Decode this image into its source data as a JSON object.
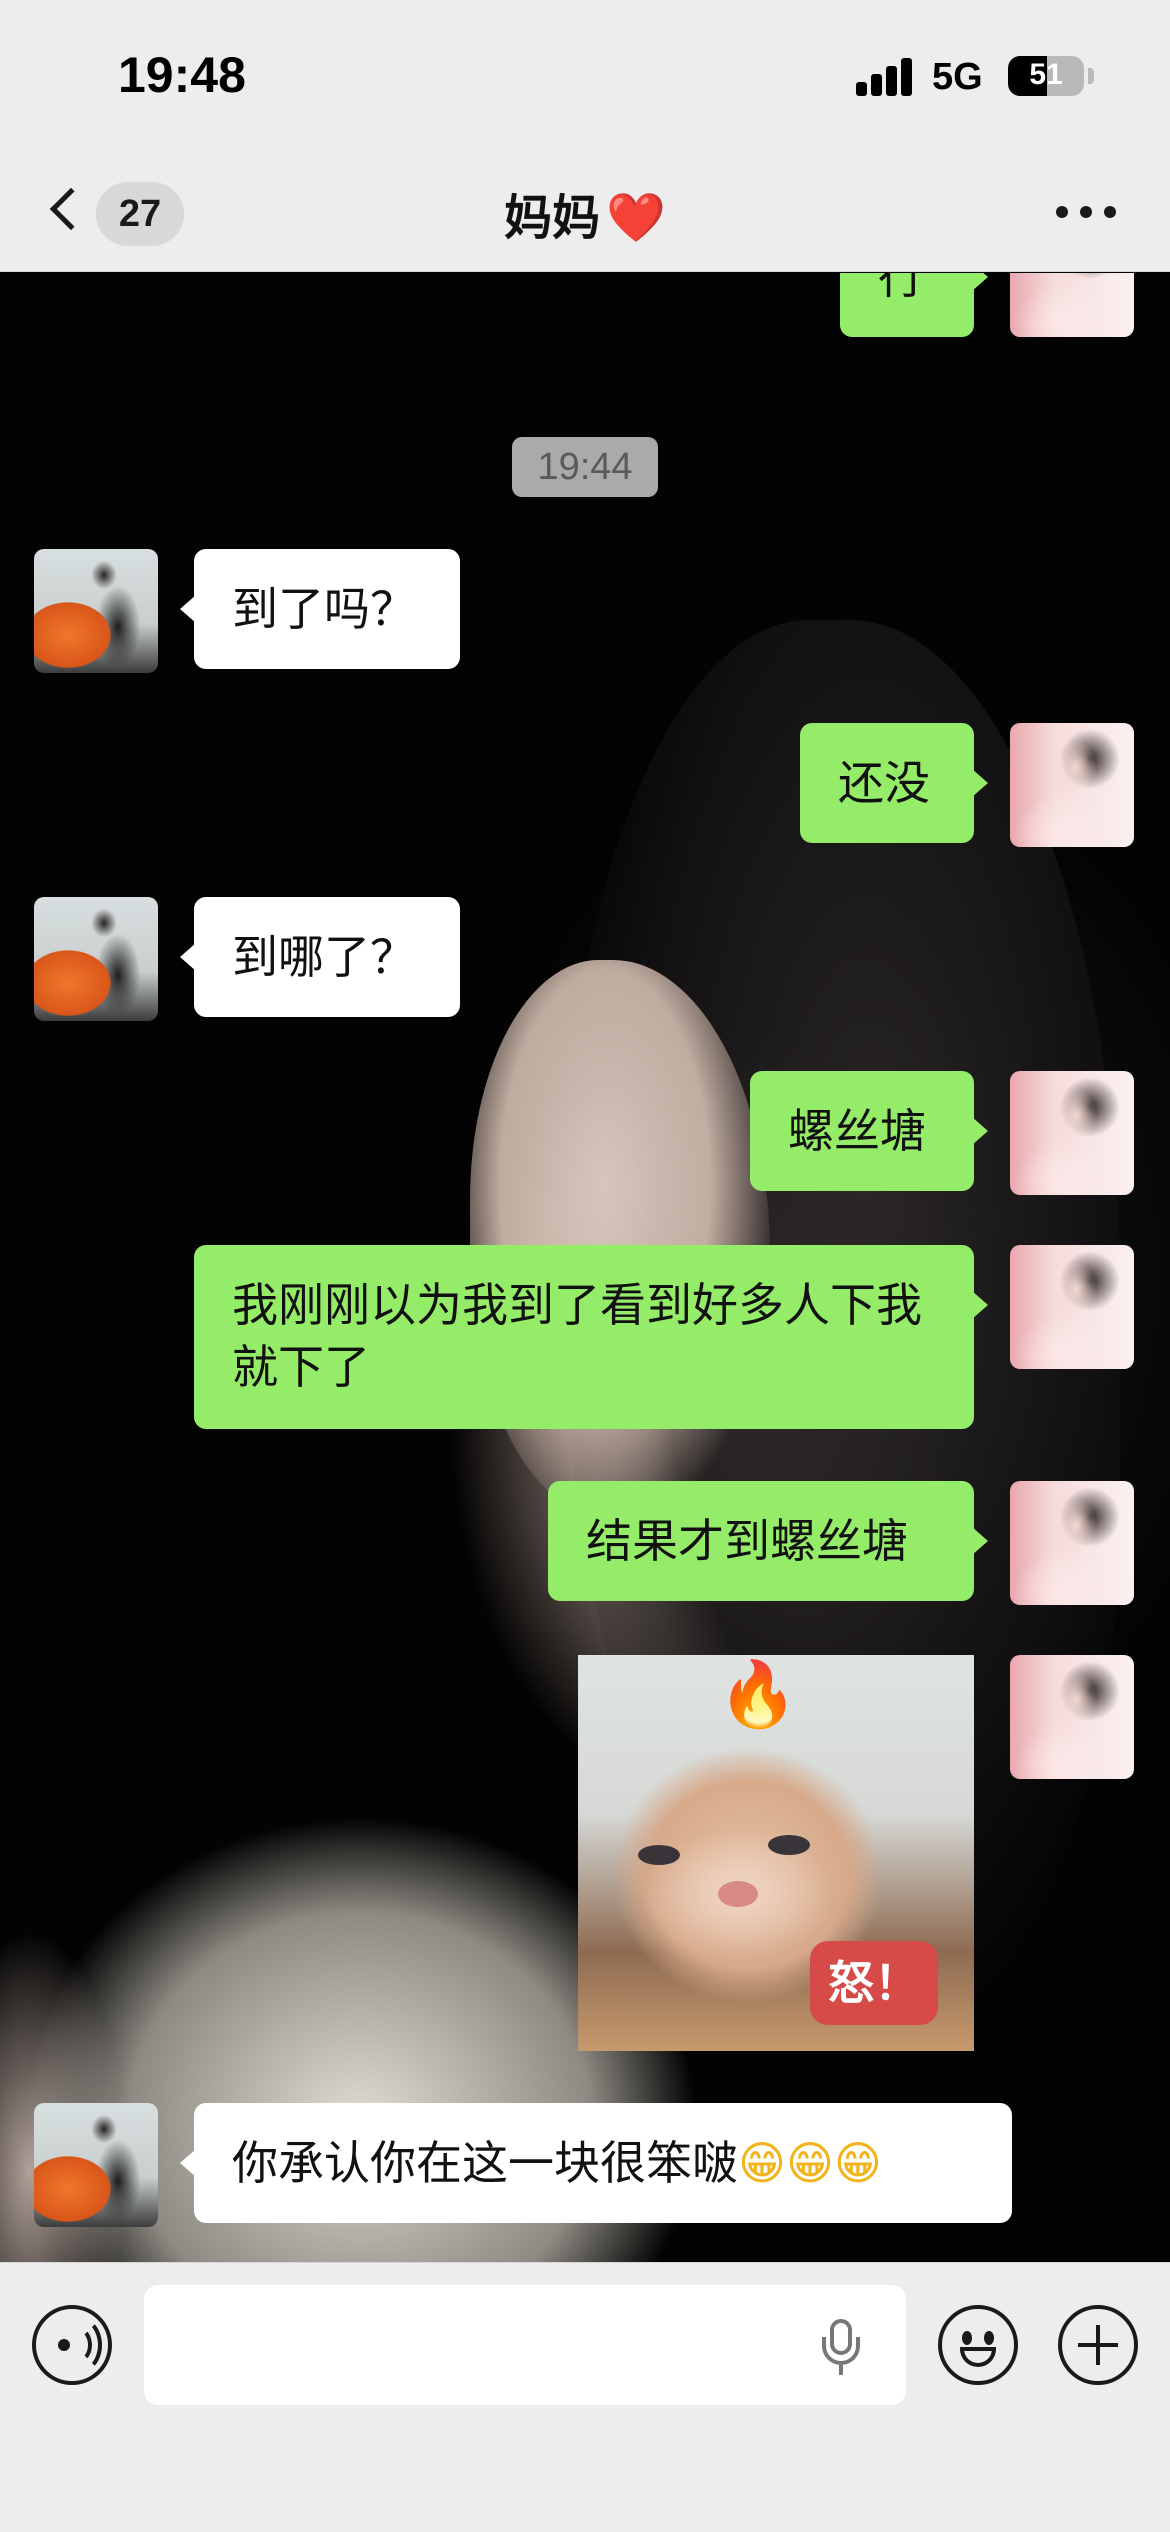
{
  "status_bar": {
    "time": "19:48",
    "network": "5G",
    "battery_level": "51",
    "battery_fraction": 0.51
  },
  "nav": {
    "unread_count": "27",
    "title": "妈妈",
    "title_emoji": "❤️"
  },
  "messages": [
    {
      "side": "sent",
      "text": "行"
    },
    {
      "type": "timestamp",
      "text": "19:44"
    },
    {
      "side": "received",
      "text": "到了吗？"
    },
    {
      "side": "sent",
      "text": "还没"
    },
    {
      "side": "received",
      "text": "到哪了？"
    },
    {
      "side": "sent",
      "text": "螺丝塘"
    },
    {
      "side": "sent",
      "text": "我刚刚以为我到了看到好多人下我就下了"
    },
    {
      "side": "sent",
      "text": "结果才到螺丝塘"
    },
    {
      "side": "sent",
      "type": "sticker",
      "caption": "怒！",
      "icon": "fire-emoji"
    },
    {
      "side": "received",
      "text": "你承认你在这一块很笨啵",
      "emoji": "😁😁😁"
    }
  ],
  "icons": {
    "back": "chevron-left-icon",
    "more": "more-dots-icon",
    "voice": "voice-input-icon",
    "mic": "microphone-icon",
    "emoji": "emoji-icon",
    "plus": "plus-icon"
  },
  "colors": {
    "sent_bubble": "#95ec69",
    "received_bubble": "#ffffff",
    "bar_background": "#ededed"
  }
}
